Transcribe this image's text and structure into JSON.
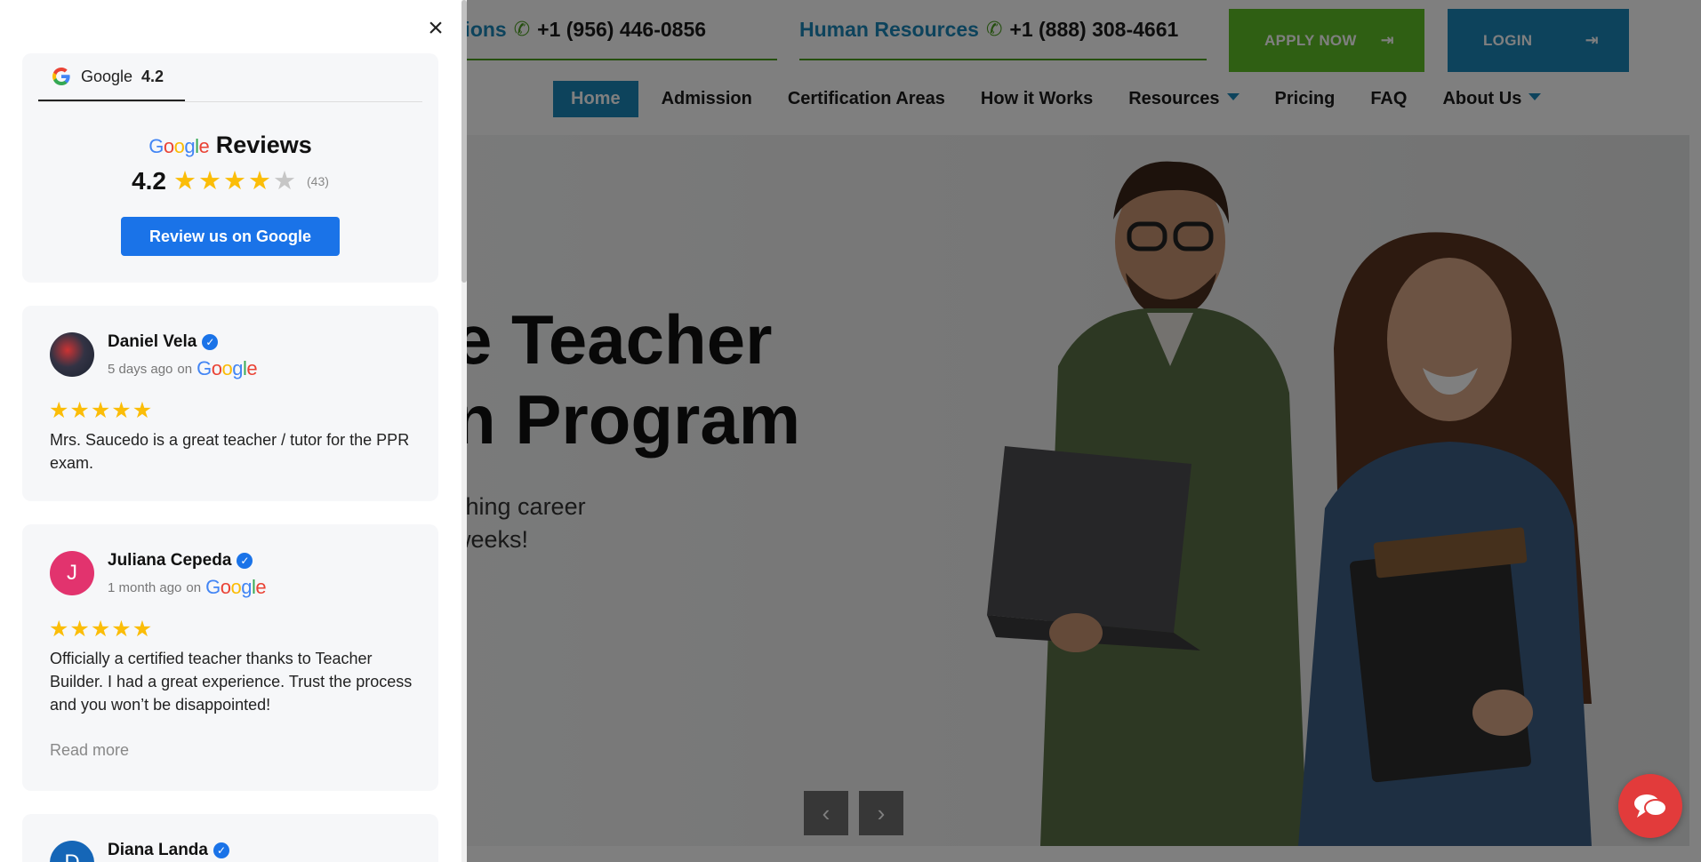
{
  "site": {
    "contacts": [
      {
        "label": "Admissions",
        "visible_label": "missions",
        "phone": "+1 (956) 446-0856"
      },
      {
        "label": "Human Resources",
        "phone": "+1 (888) 308-4661"
      }
    ],
    "apply_label": "APPLY NOW",
    "login_label": "LOGIN",
    "nav": [
      "Home",
      "Admission",
      "Certification Areas",
      "How it Works",
      "Resources",
      "Pricing",
      "FAQ",
      "About Us"
    ],
    "hero": {
      "title_line1": "e Teacher",
      "title_line2": "n Program",
      "sub_line1": "ching career",
      "sub_line2": "weeks!"
    },
    "slider_prev": "‹",
    "slider_next": "›"
  },
  "widget": {
    "close": "×",
    "tab_label": "Google",
    "tab_rating": "4.2",
    "heading_suffix": "Reviews",
    "rating": "4.2",
    "count": "(43)",
    "review_button": "Review us on Google",
    "reviews": [
      {
        "name": "Daniel Vela",
        "time": "5 days ago",
        "on": "on",
        "stars": 5,
        "text": "Mrs. Saucedo is a great teacher / tutor for the PPR exam."
      },
      {
        "name": "Juliana Cepeda",
        "initial": "J",
        "time": "1 month ago",
        "on": "on",
        "stars": 5,
        "text": "Officially a certified teacher thanks to Teacher Builder. I had a great experience. Trust the process and you won’t be disappointed!",
        "read_more": "Read more"
      },
      {
        "name": "Diana Landa",
        "initial": "D"
      }
    ]
  },
  "colors": {
    "accent_blue": "#1a86b8",
    "accent_green": "#5fbf26",
    "google_blue": "#1a73e8",
    "star": "#fbbd08",
    "chat_red": "#e23b3b"
  }
}
